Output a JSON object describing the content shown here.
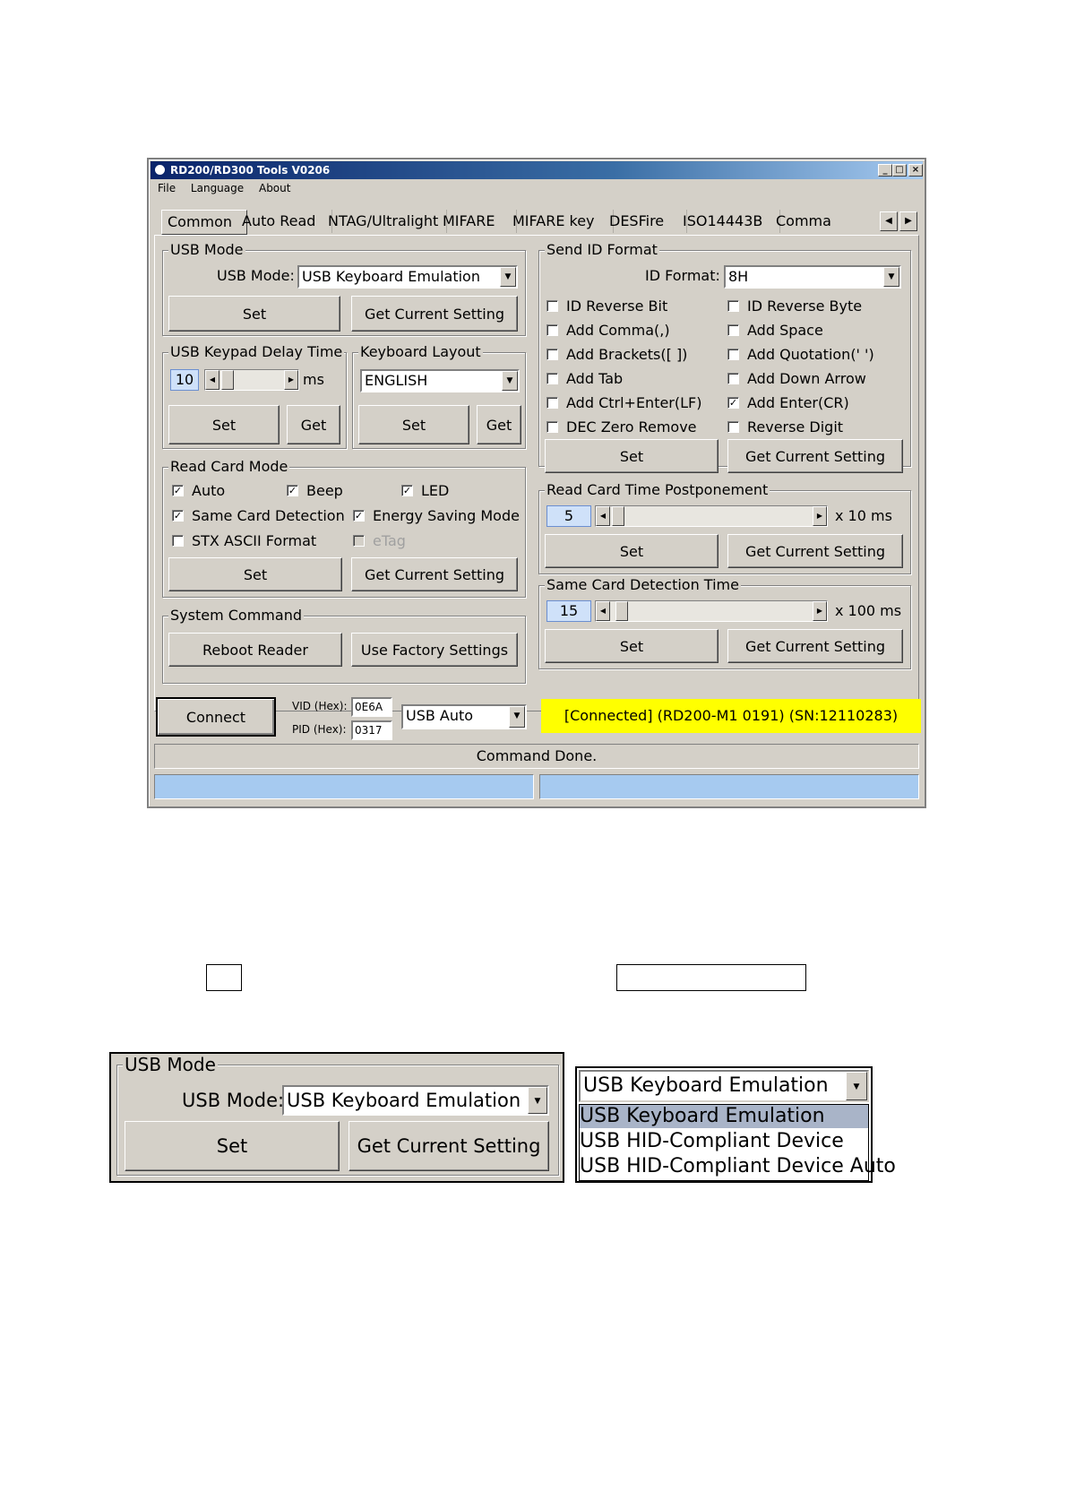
{
  "window": {
    "title": "RD200/RD300 Tools V0206",
    "menu": [
      "File",
      "Language",
      "About"
    ],
    "tabs": [
      "Common",
      "Auto Read",
      "NTAG/Ultralight",
      "MIFARE",
      "MIFARE key",
      "DESFire",
      "ISO14443B",
      "Comma"
    ],
    "active_tab": "Common"
  },
  "usb_mode": {
    "group": "USB Mode",
    "label": "USB Mode:",
    "value": "USB Keyboard Emulation",
    "set": "Set",
    "get": "Get Current Setting"
  },
  "keypad_delay": {
    "group": "USB Keypad Delay Time",
    "value": "10",
    "unit": "ms",
    "set": "Set",
    "get": "Get"
  },
  "keyboard_layout": {
    "group": "Keyboard Layout",
    "value": "ENGLISH",
    "set": "Set",
    "get": "Get"
  },
  "read_card_mode": {
    "group": "Read Card Mode",
    "options": [
      {
        "label": "Auto",
        "checked": true
      },
      {
        "label": "Beep",
        "checked": true
      },
      {
        "label": "LED",
        "checked": true
      },
      {
        "label": "Same Card Detection",
        "checked": true
      },
      {
        "label": "Energy Saving Mode",
        "checked": true
      },
      {
        "label": "STX ASCII Format",
        "checked": false
      },
      {
        "label": "eTag",
        "checked": false,
        "disabled": true
      }
    ],
    "set": "Set",
    "get": "Get Current Setting"
  },
  "system_command": {
    "group": "System Command",
    "reboot": "Reboot Reader",
    "factory": "Use Factory Settings"
  },
  "send_id_format": {
    "group": "Send ID Format",
    "label": "ID Format:",
    "value": "8H",
    "options": [
      {
        "label": "ID Reverse Bit",
        "checked": false
      },
      {
        "label": "ID Reverse Byte",
        "checked": false
      },
      {
        "label": "Add Comma(,)",
        "checked": false
      },
      {
        "label": "Add Space",
        "checked": false
      },
      {
        "label": "Add Brackets([ ])",
        "checked": false
      },
      {
        "label": "Add Quotation(' ')",
        "checked": false
      },
      {
        "label": "Add Tab",
        "checked": false
      },
      {
        "label": "Add Down Arrow",
        "checked": false
      },
      {
        "label": "Add Ctrl+Enter(LF)",
        "checked": false
      },
      {
        "label": "Add Enter(CR)",
        "checked": true
      },
      {
        "label": "DEC Zero Remove",
        "checked": false
      },
      {
        "label": "Reverse Digit",
        "checked": false
      }
    ],
    "set": "Set",
    "get": "Get Current Setting"
  },
  "postponement": {
    "group": "Read Card Time Postponement",
    "value": "5",
    "unit": "x 10 ms",
    "set": "Set",
    "get": "Get Current Setting"
  },
  "same_card_time": {
    "group": "Same Card Detection Time",
    "value": "15",
    "unit": "x 100 ms",
    "set": "Set",
    "get": "Get Current Setting"
  },
  "connection": {
    "connect": "Connect",
    "vid_label": "VID (Hex):",
    "vid": "0E6A",
    "pid_label": "PID (Hex):",
    "pid": "0317",
    "mode": "USB Auto",
    "status": "[Connected] (RD200-M1      0191) (SN:12110283)",
    "message": "Command Done."
  },
  "zoom_usb_mode": {
    "group": "USB Mode",
    "label": "USB Mode:",
    "value": "USB Keyboard Emulation",
    "set": "Set",
    "get": "Get Current Setting"
  },
  "zoom_dropdown": {
    "value": "USB Keyboard Emulation",
    "options": [
      "USB Keyboard Emulation",
      "USB HID-Compliant Device",
      "USB HID-Compliant Device Auto"
    ],
    "selected_index": 0
  },
  "colors": {
    "status_bg": "#ffff00",
    "progress": "#a6caf0",
    "selected": "#a9b4c8"
  }
}
